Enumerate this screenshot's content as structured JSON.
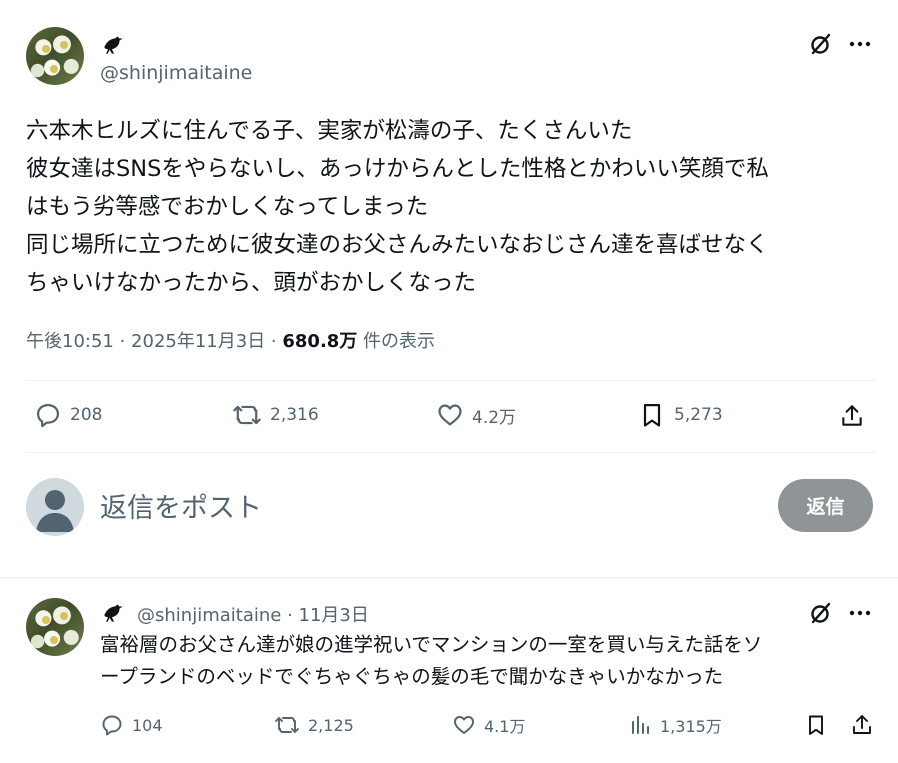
{
  "main_tweet": {
    "handle": "@shinjimaitaine",
    "text_lines": [
      "六本木ヒルズに住んでる子、実家が松濤の子、たくさんいた",
      "彼女達はSNSをやらないし、あっけからんとした性格とかわいい笑顔で私",
      "はもう劣等感でおかしくなってしまった",
      "同じ場所に立つために彼女達のお父さんみたいなおじさん達を喜ばせなく",
      "ちゃいけなかったから、頭がおかしくなった"
    ],
    "time": "午後10:51 · 2025年11月3日 · ",
    "views": "680.8万",
    "views_suffix": " 件の表示",
    "stats": {
      "replies": "208",
      "reposts": "2,316",
      "likes": "4.2万",
      "bookmarks": "5,273"
    }
  },
  "reply_composer": {
    "placeholder": "返信をポスト",
    "button_label": "返信"
  },
  "reply_tweet": {
    "handle": "@shinjimaitaine",
    "date": "11月3日",
    "text_lines": [
      "富裕層のお父さん達が娘の進学祝いでマンションの一室を買い与えた話をソ",
      "ープランドのベッドでぐちゃぐちゃの髪の毛で聞かなきゃいかなかった"
    ],
    "stats": {
      "replies": "104",
      "reposts": "2,125",
      "likes": "4.1万",
      "views": "1,315万"
    }
  },
  "icons": {
    "crow": "crow-icon",
    "grok": "grok-icon",
    "more": "more-icon",
    "reply": "reply-icon",
    "repost": "repost-icon",
    "like": "heart-icon",
    "bookmark": "bookmark-icon",
    "share": "share-icon",
    "views": "views-icon"
  },
  "colors": {
    "text": "#0f1419",
    "secondary": "#536471",
    "reply_button": "#8f9496",
    "divider": "#eff3f4"
  }
}
